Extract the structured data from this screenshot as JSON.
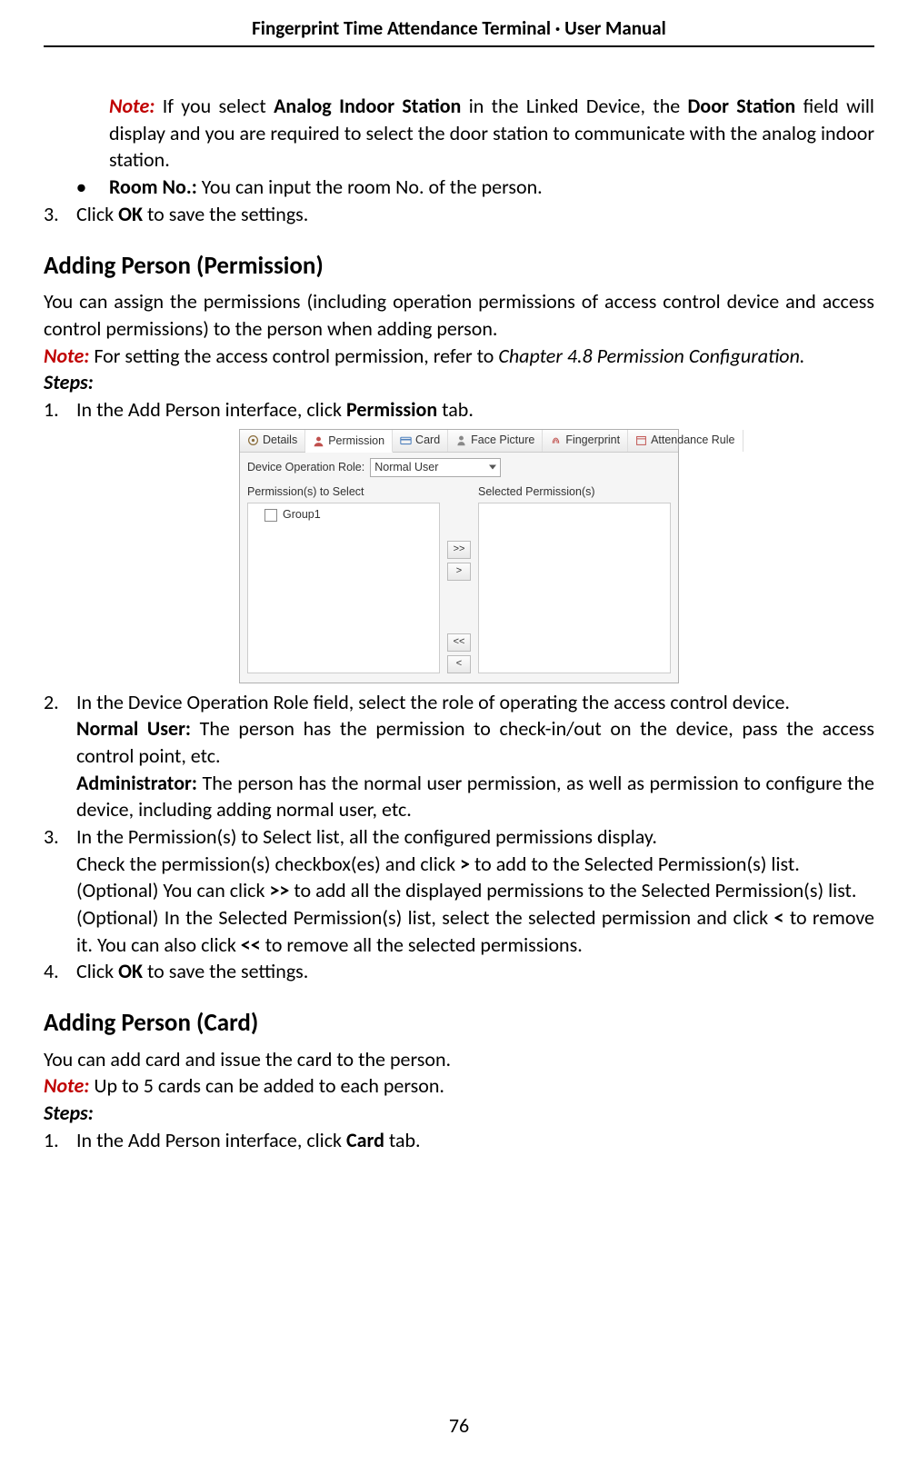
{
  "header": {
    "title": "Fingerprint Time Attendance Terminal · User Manual"
  },
  "top": {
    "note_label": "Note:",
    "note_text_1": " If you select ",
    "note_b1": "Analog Indoor Station",
    "note_text_2": " in the Linked Device, the ",
    "note_b2": "Door Station",
    "note_text_3": " field will display and you are required to select the door station to communicate with the analog indoor station.",
    "roomno_b": "Room No.:",
    "roomno_text": " You can input the room No. of the person.",
    "step3_num": "3.",
    "step3_a": "Click ",
    "step3_b": "OK",
    "step3_c": " to save the settings."
  },
  "perm": {
    "heading": "Adding Person (Permission)",
    "intro": "You can assign the permissions (including operation permissions of access control device and access control permissions) to the person when adding person.",
    "note_label": "Note:",
    "note_text_a": " For setting the access control permission, refer to ",
    "note_it": "Chapter 4.8 Permission Configuration.",
    "steps_label": "Steps:",
    "s1_num": "1.",
    "s1_a": "In the Add Person interface, click ",
    "s1_b": "Permission",
    "s1_c": " tab.",
    "ui": {
      "tabs": {
        "details": "Details",
        "permission": "Permission",
        "card": "Card",
        "face": "Face Picture",
        "fingerprint": "Fingerprint",
        "attendance": "Attendance Rule"
      },
      "role_label": "Device Operation Role:",
      "role_value": "Normal User",
      "left_heading": "Permission(s) to Select",
      "right_heading": "Selected Permission(s)",
      "group1": "Group1",
      "btn_all_right": ">>",
      "btn_right": ">",
      "btn_all_left": "<<",
      "btn_left": "<"
    },
    "s2_num": "2.",
    "s2_text": "In the Device Operation Role field, select the role of operating the access control device.",
    "s2_nu_b": "Normal User:",
    "s2_nu_t": " The person has the permission to check-in/out on the device, pass the access control point, etc.",
    "s2_ad_b": "Administrator:",
    "s2_ad_t": " The person has the normal user permission, as well as permission to configure the device, including adding normal user, etc.",
    "s3_num": "3.",
    "s3_l1": "In the Permission(s) to Select list, all the configured permissions display.",
    "s3_l2_a": "Check the permission(s) checkbox(es) and click ",
    "s3_l2_b": ">",
    "s3_l2_c": " to add to the Selected Permission(s) list.",
    "s3_l3_a": "(Optional) You can click ",
    "s3_l3_b": ">>",
    "s3_l3_c": " to add all the displayed permissions to the Selected Permission(s) list.",
    "s3_l4_a": "(Optional) In the Selected Permission(s) list, select the selected permission and click ",
    "s3_l4_b": "<",
    "s3_l4_c": " to remove it. You can also click ",
    "s3_l4_d": "<<",
    "s3_l4_e": " to remove all the selected permissions.",
    "s4_num": "4.",
    "s4_a": "Click ",
    "s4_b": "OK",
    "s4_c": " to save the settings."
  },
  "card": {
    "heading": "Adding Person (Card)",
    "intro": "You can add card and issue the card to the person.",
    "note_label": "Note:",
    "note_text": " Up to 5 cards can be added to each person.",
    "steps_label": "Steps:",
    "s1_num": "1.",
    "s1_a": "In the Add Person interface, click ",
    "s1_b": "Card",
    "s1_c": " tab."
  },
  "page_number": "76"
}
